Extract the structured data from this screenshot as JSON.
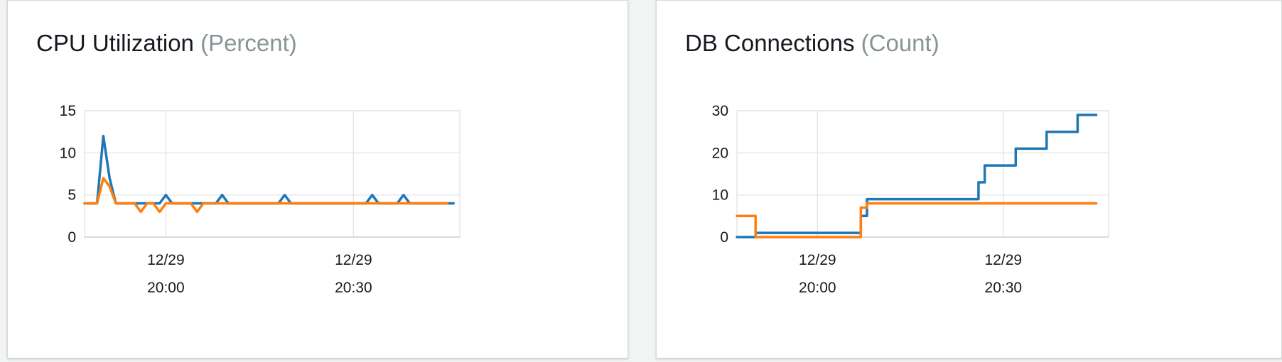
{
  "colors": {
    "series_blue": "#1f77b4",
    "series_orange": "#ff7f0e",
    "grid": "#e6e6e6",
    "axis_text": "#16191f",
    "unit_text": "#879596"
  },
  "chart_data": [
    {
      "type": "line",
      "title": "CPU Utilization",
      "unit": "(Percent)",
      "x_ticks": [
        {
          "x": 0,
          "date": "12/29",
          "time": "20:00"
        },
        {
          "x": 30,
          "date": "12/29",
          "time": "20:30"
        }
      ],
      "xlim": [
        -13,
        47
      ],
      "ylim": [
        0,
        15
      ],
      "y_ticks": [
        0,
        5,
        10,
        15
      ],
      "grid": true,
      "series": [
        {
          "color": "#1f77b4",
          "x": [
            -13,
            -11,
            -10,
            -9,
            -8,
            -7,
            -5,
            -4,
            -3,
            -2,
            -1,
            0,
            1,
            2,
            3,
            4,
            5,
            6,
            7,
            8,
            9,
            10,
            11,
            12,
            13,
            14,
            15,
            16,
            17,
            18,
            19,
            20,
            21,
            22,
            23,
            24,
            25,
            26,
            27,
            28,
            29,
            30,
            31,
            32,
            33,
            34,
            35,
            36,
            37,
            38,
            39,
            40,
            41,
            42,
            43,
            44,
            45,
            46
          ],
          "y": [
            4,
            4,
            12,
            7,
            4,
            4,
            4,
            4,
            4,
            4,
            4,
            5,
            4,
            4,
            4,
            4,
            4,
            4,
            4,
            4,
            5,
            4,
            4,
            4,
            4,
            4,
            4,
            4,
            4,
            4,
            5,
            4,
            4,
            4,
            4,
            4,
            4,
            4,
            4,
            4,
            4,
            4,
            4,
            4,
            5,
            4,
            4,
            4,
            4,
            5,
            4,
            4,
            4,
            4,
            4,
            4,
            4,
            4
          ]
        },
        {
          "color": "#ff7f0e",
          "x": [
            -13,
            -11,
            -10,
            -9,
            -8,
            -7,
            -6,
            -5,
            -4,
            -3,
            -2,
            -1,
            0,
            1,
            2,
            3,
            4,
            5,
            6,
            7,
            8,
            9,
            10,
            11,
            12,
            13,
            14,
            15,
            16,
            17,
            18,
            19,
            20,
            21,
            22,
            23,
            24,
            25,
            26,
            27,
            28,
            29,
            30,
            31,
            32,
            33,
            34,
            35,
            36,
            37,
            38,
            39,
            40,
            41,
            42,
            43,
            44,
            45
          ],
          "y": [
            4,
            4,
            7,
            6,
            4,
            4,
            4,
            4,
            3,
            4,
            4,
            3,
            4,
            4,
            4,
            4,
            4,
            3,
            4,
            4,
            4,
            4,
            4,
            4,
            4,
            4,
            4,
            4,
            4,
            4,
            4,
            4,
            4,
            4,
            4,
            4,
            4,
            4,
            4,
            4,
            4,
            4,
            4,
            4,
            4,
            4,
            4,
            4,
            4,
            4,
            4,
            4,
            4,
            4,
            4,
            4,
            4,
            4
          ]
        }
      ]
    },
    {
      "type": "line",
      "title": "DB Connections",
      "unit": "(Count)",
      "x_ticks": [
        {
          "x": 0,
          "date": "12/29",
          "time": "20:00"
        },
        {
          "x": 30,
          "date": "12/29",
          "time": "20:30"
        }
      ],
      "xlim": [
        -13,
        47
      ],
      "ylim": [
        0,
        30
      ],
      "y_ticks": [
        0,
        10,
        20,
        30
      ],
      "grid": true,
      "series": [
        {
          "color": "#1f77b4",
          "x": [
            -13,
            -10,
            -10,
            7,
            7,
            8,
            8,
            26,
            26,
            27,
            27,
            32,
            32,
            37,
            37,
            42,
            42,
            45
          ],
          "y": [
            0,
            0,
            1,
            1,
            5,
            5,
            9,
            9,
            13,
            13,
            17,
            17,
            21,
            21,
            25,
            25,
            29,
            29
          ]
        },
        {
          "color": "#ff7f0e",
          "x": [
            -13,
            -10,
            -10,
            7,
            7,
            8,
            8,
            45
          ],
          "y": [
            5,
            5,
            0,
            0,
            7,
            7,
            8,
            8
          ]
        }
      ]
    }
  ]
}
